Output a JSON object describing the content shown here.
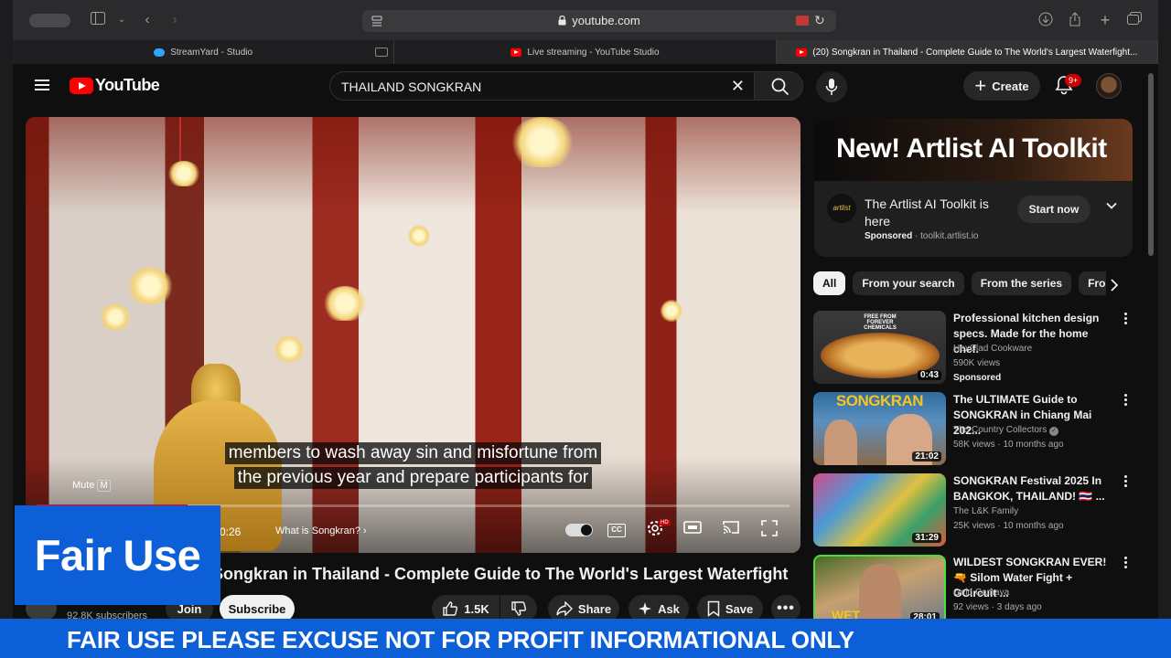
{
  "browser": {
    "address": "youtube.com",
    "tabs": [
      {
        "label": "StreamYard - Studio"
      },
      {
        "label": "Live streaming - YouTube Studio"
      },
      {
        "label": "(20) Songkran in Thailand - Complete Guide to The World's Largest Waterfight..."
      }
    ]
  },
  "header": {
    "logo_text": "YouTube",
    "search_value": "THAILAND SONGKRAN",
    "create_label": "Create",
    "notification_count": "9+"
  },
  "player": {
    "subtitle_lines": [
      "members to wash away sin and misfortune from",
      "the previous year and prepare participants for"
    ],
    "mute_label": "Mute",
    "mute_key": "M",
    "time": "0:26",
    "chapter": "What is Songkran?",
    "progress": 0.2
  },
  "video": {
    "title": "Songkran in Thailand - Complete Guide to The World's Largest Waterfight",
    "subscribers": "92.8K subscribers",
    "join_label": "Join",
    "subscribe_label": "Subscribe",
    "likes": "1.5K",
    "share_label": "Share",
    "ask_label": "Ask",
    "save_label": "Save"
  },
  "ad": {
    "banner": "New! Artlist AI Toolkit",
    "logo_text": "artlist",
    "title": "The Artlist AI Toolkit is here",
    "sponsored": "Sponsored",
    "domain": "toolkit.artlist.io",
    "cta": "Start now"
  },
  "chips": [
    "All",
    "From your search",
    "From the series",
    "Fro"
  ],
  "recommendations": [
    {
      "title": "Professional kitchen design specs. Made for the home chef.",
      "channel": "HexClad Cookware",
      "meta": "590K views",
      "sponsored": "Sponsored",
      "duration": "0:43",
      "thumb_text": "FREE FROM FOREVER CHEMICALS"
    },
    {
      "title": "The ULTIMATE Guide to SONGKRAN in Chiang Mai 202...",
      "channel": "The Country Collectors",
      "meta": "58K views · 10 months ago",
      "duration": "21:02",
      "thumb_text": "SONGKRAN"
    },
    {
      "title": "SONGKRAN Festival 2025 In BANGKOK, THAILAND! 🇹🇭 ...",
      "channel": "The L&K Family",
      "meta": "25K views · 10 months ago",
      "duration": "31:29"
    },
    {
      "title": "WILDEST SONGKRAN EVER! 🔫 Silom Water Fight + GCircuit ...",
      "channel": "Gelo Camaya",
      "meta": "92 views · 3 days ago",
      "duration": "28:01",
      "thumb_text": "WET"
    }
  ],
  "overlay": {
    "fair_use": "Fair Use",
    "banner": "FAIR USE PLEASE EXCUSE NOT FOR PROFIT INFORMATIONAL ONLY"
  }
}
